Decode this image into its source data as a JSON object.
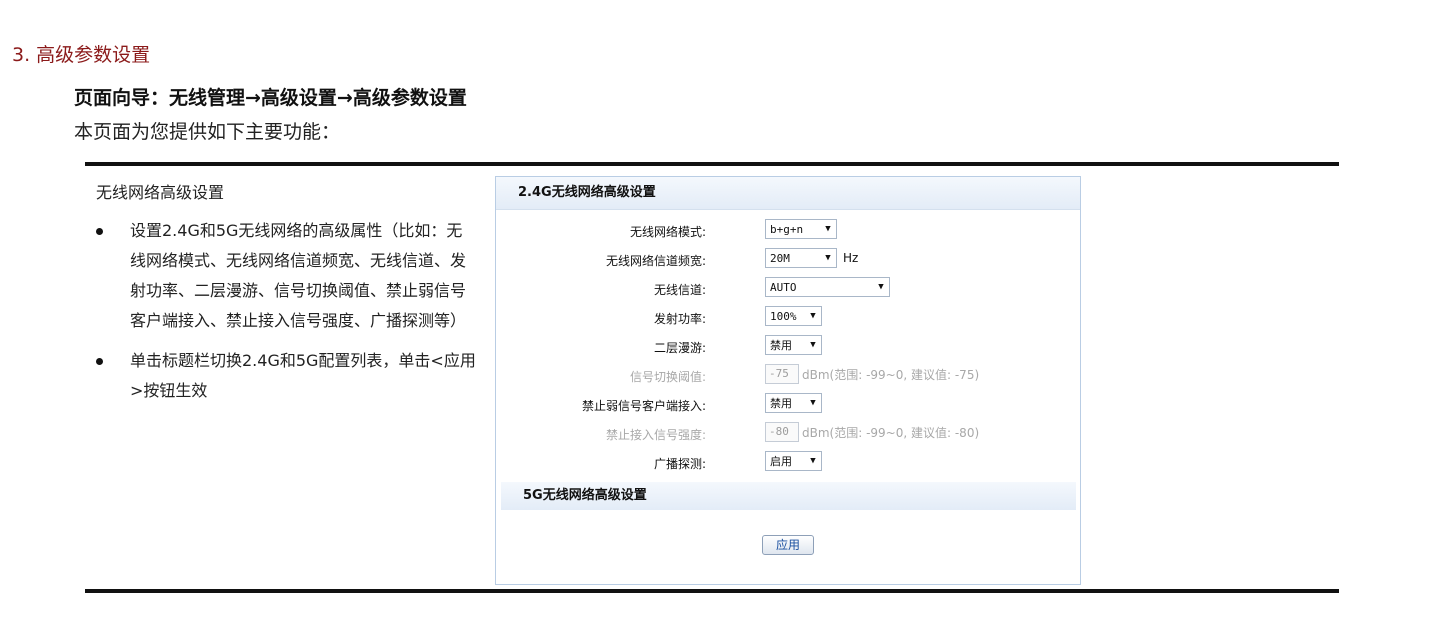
{
  "section_title": "3. 高级参数设置",
  "nav_path": "页面向导：无线管理→高级设置→高级参数设置",
  "intro": "本页面为您提供如下主要功能：",
  "left": {
    "heading": "无线网络高级设置",
    "bullets": [
      "设置2.4G和5G无线网络的高级属性（比如：无线网络模式、无线网络信道频宽、无线信道、发射功率、二层漫游、信号切换阈值、禁止弱信号客户端接入、禁止接入信号强度、广播探测等）",
      "单击标题栏切换2.4G和5G配置列表，单击<应用>按钮生效"
    ]
  },
  "panel": {
    "header_24g": "2.4G无线网络高级设置",
    "header_5g": "5G无线网络高级设置",
    "apply_label": "应用",
    "fields": {
      "mode": {
        "label": "无线网络模式:",
        "value": "b+g+n"
      },
      "bandwidth": {
        "label": "无线网络信道频宽:",
        "value": "20M",
        "unit": "Hz"
      },
      "channel": {
        "label": "无线信道:",
        "value": "AUTO"
      },
      "power": {
        "label": "发射功率:",
        "value": "100%"
      },
      "roaming": {
        "label": "二层漫游:",
        "value": "禁用"
      },
      "switch_threshold": {
        "label": "信号切换阈值:",
        "value": "-75",
        "hint": "dBm(范围: -99~0, 建议值: -75)"
      },
      "weak_client": {
        "label": "禁止弱信号客户端接入:",
        "value": "禁用"
      },
      "access_strength": {
        "label": "禁止接入信号强度:",
        "value": "-80",
        "hint": "dBm(范围: -99~0, 建议值: -80)"
      },
      "probe": {
        "label": "广播探测:",
        "value": "启用"
      }
    }
  },
  "icons": {
    "dropdown": "chevron-down-icon",
    "bullet": "bullet-dot-icon"
  },
  "colors": {
    "section_title": "#8b1a1a",
    "panel_border": "#b9cde4",
    "header_bg": "#e3ecf7",
    "disabled_text": "#a8a8a8"
  }
}
